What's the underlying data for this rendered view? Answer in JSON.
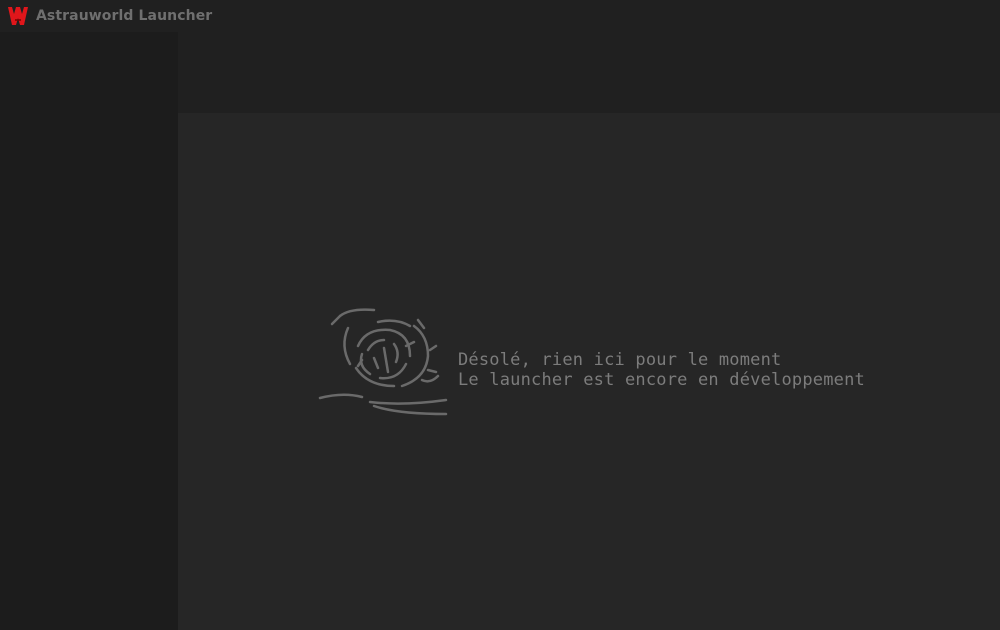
{
  "window": {
    "title": "Astrauworld Launcher",
    "logo_icon": "astrauworld-logo-icon",
    "accent_color": "#e0161b"
  },
  "main": {
    "empty_state": {
      "icon": "tumbleweed-icon",
      "line1": "Désolé, rien ici pour le moment",
      "line2": "Le launcher est encore en développement"
    }
  }
}
